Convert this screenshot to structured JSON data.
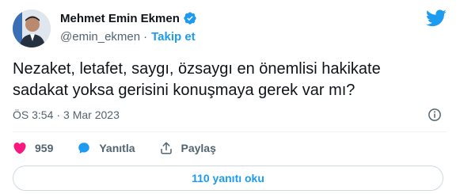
{
  "author": {
    "display_name": "Mehmet Emin Ekmen",
    "handle": "@emin_ekmen",
    "separator": "·",
    "follow_label": "Takip et"
  },
  "tweet": {
    "text": "Nezaket, letafet, saygı, özsaygı en önemlisi hakikate\nsadakat yoksa gerisini konuşmaya gerek var mı?",
    "time": "ÖS 3:54",
    "separator": "·",
    "date": "3 Mar 2023"
  },
  "actions": {
    "like_count": "959",
    "reply_label": "Yanıtla",
    "share_label": "Paylaş"
  },
  "read_replies_label": "110 yanıtı oku",
  "colors": {
    "accent": "#1d9bf0",
    "like": "#f91880",
    "muted_text": "#536471",
    "main_text": "#0f1419"
  },
  "icons": {
    "verified": "verified-badge-icon",
    "brand": "twitter-bird-icon",
    "info": "info-icon",
    "like": "heart-icon",
    "reply": "reply-bubble-icon",
    "share": "share-icon"
  }
}
